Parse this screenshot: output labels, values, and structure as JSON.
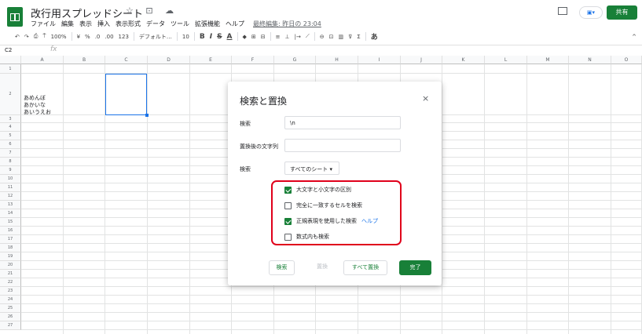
{
  "header": {
    "doc_title": "改行用スプレッドシート",
    "title_icons": "☆ ⊡ ☁",
    "menu": [
      "ファイル",
      "編集",
      "表示",
      "挿入",
      "表示形式",
      "データ",
      "ツール",
      "拡張機能",
      "ヘルプ"
    ],
    "last_edit": "最終編集: 昨日の 23:04",
    "share_label": "共有",
    "meet_label": "▣▾"
  },
  "toolbar": {
    "undo": "↶",
    "redo": "↷",
    "print": "⎙",
    "paint": "⍑",
    "zoom": "100%",
    "currency": "¥",
    "percent": "%",
    "dec_less": ".0",
    "dec_more": ".00",
    "format_more": "123",
    "font": "デフォルト…",
    "font_size": "10",
    "bold": "B",
    "italic": "I",
    "strike": "S",
    "text_color": "A",
    "fill": "◆",
    "borders": "⊞",
    "merge": "⊟",
    "halign": "≡",
    "valign": "⊥",
    "wrap": "|→",
    "rotate": "⟋",
    "link": "⊖",
    "comment": "⊡",
    "chart": "▥",
    "filter": "⊽",
    "functions": "Σ",
    "input_tools": "あ",
    "collapse": "^"
  },
  "formula_bar": {
    "cell_ref": "C2",
    "fx": "fx"
  },
  "sheet": {
    "columns": [
      "A",
      "B",
      "C",
      "D",
      "E",
      "F",
      "G",
      "H",
      "I",
      "J",
      "K",
      "L",
      "M",
      "N",
      "O"
    ],
    "rows": [
      "1",
      "2",
      "3",
      "4",
      "5",
      "6",
      "7",
      "8",
      "9",
      "10",
      "11",
      "12",
      "13",
      "14",
      "15",
      "16",
      "17",
      "18",
      "19",
      "20",
      "21",
      "22",
      "23",
      "24",
      "25",
      "26",
      "27"
    ],
    "cell_a2": "あめんぼ\nあかいな\nあいうえお"
  },
  "dialog": {
    "title": "検索と置換",
    "close": "×",
    "search_label": "検索",
    "search_value": "\\n",
    "replace_label": "置換後の文字列",
    "replace_value": "",
    "scope_label": "検索",
    "scope_value": "すべてのシート",
    "options": [
      {
        "label": "大文字と小文字の区別",
        "checked": true
      },
      {
        "label": "完全に一致するセルを検索",
        "checked": false
      },
      {
        "label": "正規表現を使用した検索",
        "checked": true
      },
      {
        "label": "数式内も検索",
        "checked": false
      }
    ],
    "help_link": "ヘルプ",
    "buttons": {
      "find": "検索",
      "replace": "置換",
      "replace_all": "すべて置換",
      "done": "完了"
    }
  },
  "colors": {
    "brand_green": "#188038",
    "highlight_red": "#e0001b",
    "link_blue": "#1a73e8"
  }
}
